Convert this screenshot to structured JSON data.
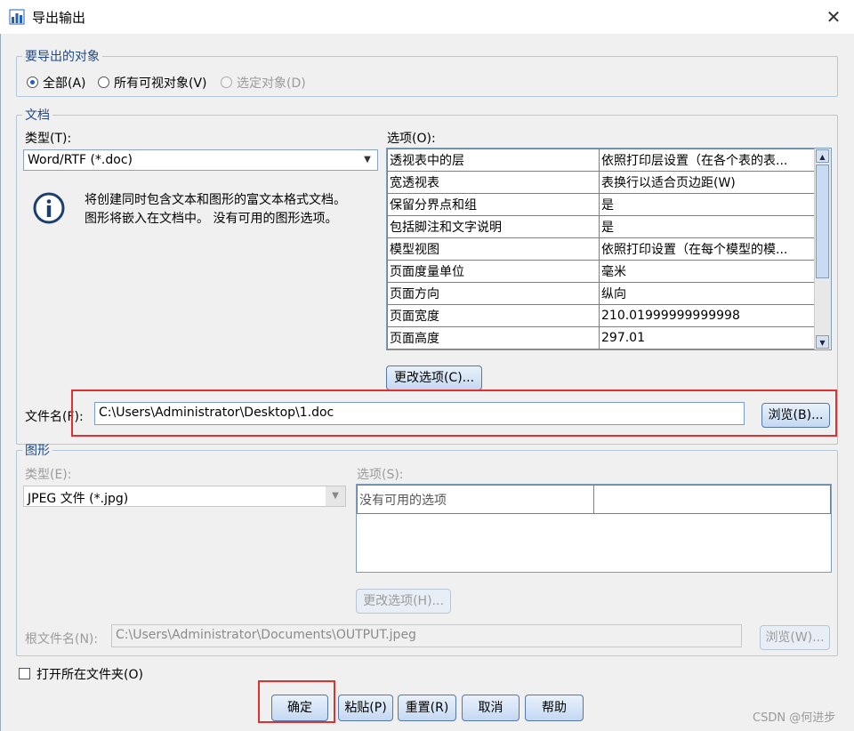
{
  "window": {
    "title": "导出输出",
    "close_glyph": "✕"
  },
  "objects_group": {
    "legend": "要导出的对象",
    "options": [
      {
        "label": "全部(A)",
        "selected": true,
        "enabled": true
      },
      {
        "label": "所有可视对象(V)",
        "selected": false,
        "enabled": true
      },
      {
        "label": "选定对象(D)",
        "selected": false,
        "enabled": false
      }
    ]
  },
  "document_group": {
    "legend": "文档",
    "type_label": "类型(T):",
    "type_value": "Word/RTF (*.doc)",
    "info_text_1": "将创建同时包含文本和图形的富文本格式文档。",
    "info_text_2": "图形将嵌入在文档中。 没有可用的图形选项。",
    "options_label": "选项(O):",
    "options_rows": [
      {
        "key": "透视表中的层",
        "value": "依照打印层设置（在各个表的表..."
      },
      {
        "key": "宽透视表",
        "value": "表换行以适合页边距(W)"
      },
      {
        "key": "保留分界点和组",
        "value": "是"
      },
      {
        "key": "包括脚注和文字说明",
        "value": "是"
      },
      {
        "key": "模型视图",
        "value": "依照打印设置（在每个模型的模..."
      },
      {
        "key": "页面度量单位",
        "value": "毫米"
      },
      {
        "key": "页面方向",
        "value": "纵向"
      },
      {
        "key": "页面宽度",
        "value": "210.01999999999998"
      },
      {
        "key": "页面高度",
        "value": "297.01"
      }
    ],
    "change_options_button": "更改选项(C)...",
    "filename_label": "文件名(F):",
    "filename_value": "C:\\Users\\Administrator\\Desktop\\1.doc",
    "browse_button": "浏览(B)..."
  },
  "graphics_group": {
    "legend": "图形",
    "type_label": "类型(E):",
    "type_value": "JPEG 文件 (*.jpg)",
    "options_label": "选项(S):",
    "options_row": "没有可用的选项",
    "change_options_button": "更改选项(H)...",
    "root_filename_label": "根文件名(N):",
    "root_filename_value": "C:\\Users\\Administrator\\Documents\\OUTPUT.jpeg",
    "browse_button": "浏览(W)..."
  },
  "open_folder_checkbox": {
    "label": "打开所在文件夹(O)",
    "checked": false
  },
  "footer_buttons": {
    "ok": "确定",
    "paste": "粘贴(P)",
    "reset": "重置(R)",
    "cancel": "取消",
    "help": "帮助"
  },
  "watermark": "CSDN @何进步"
}
